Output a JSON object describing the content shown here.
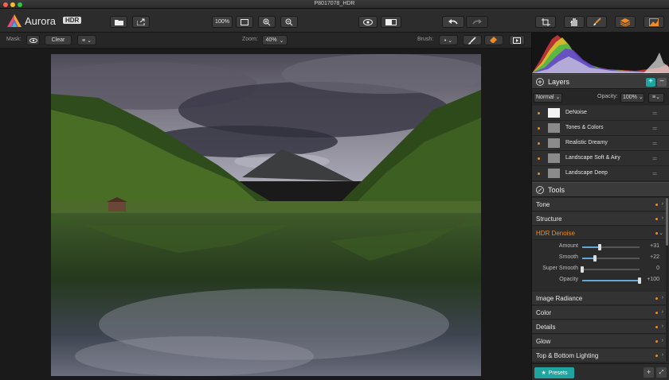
{
  "window": {
    "title": "P8017078_HDR"
  },
  "app": {
    "name_prefix": "Aurora",
    "name_badge": "HDR"
  },
  "toolbar": {
    "zoom_fit": "100%"
  },
  "subbar": {
    "mask_label": "Mask:",
    "clear_label": "Clear",
    "zoom_label": "Zoom:",
    "zoom_value": "40%",
    "brush_label": "Brush:"
  },
  "layers": {
    "title": "Layers",
    "blend_mode": "Normal",
    "opacity_label": "Opacity:",
    "opacity_value": "100%",
    "items": [
      {
        "name": "DeNoise"
      },
      {
        "name": "Tones & Colors"
      },
      {
        "name": "Realistic Dreamy"
      },
      {
        "name": "Landscape Soft & Airy"
      },
      {
        "name": "Landscape Deep"
      }
    ]
  },
  "tools": {
    "title": "Tools",
    "sections_top": [
      {
        "name": "Tone"
      },
      {
        "name": "Structure"
      }
    ],
    "open_section": {
      "name": "HDR Denoise",
      "sliders": [
        {
          "label": "Amount",
          "value": "+31",
          "level": 0.31
        },
        {
          "label": "Smooth",
          "value": "+22",
          "level": 0.22
        },
        {
          "label": "Super Smooth",
          "value": "0",
          "level": 0.0
        },
        {
          "label": "Opacity",
          "value": "+100",
          "level": 1.0
        }
      ]
    },
    "sections_bottom": [
      {
        "name": "Image Radiance"
      },
      {
        "name": "Color"
      },
      {
        "name": "Details"
      },
      {
        "name": "Glow"
      },
      {
        "name": "Top & Bottom Lighting"
      }
    ]
  },
  "footer": {
    "presets_label": "Presets"
  },
  "colors": {
    "accent_orange": "#f08a24",
    "accent_teal": "#1fa4a0",
    "slider_blue": "#5fa8d9"
  }
}
